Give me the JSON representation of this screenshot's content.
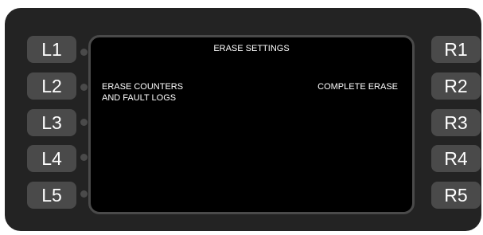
{
  "screen": {
    "title": "ERASE SETTINGS",
    "left_option_line1": "ERASE COUNTERS",
    "left_option_line2": "AND FAULT LOGS",
    "right_option": "COMPLETE ERASE"
  },
  "left_keys": [
    "L1",
    "L2",
    "L3",
    "L4",
    "L5"
  ],
  "right_keys": [
    "R1",
    "R2",
    "R3",
    "R4",
    "R5"
  ],
  "colors": {
    "bezel": "#232323",
    "key": "#4a4a4a",
    "screen": "#000000",
    "text": "#ffffff"
  }
}
